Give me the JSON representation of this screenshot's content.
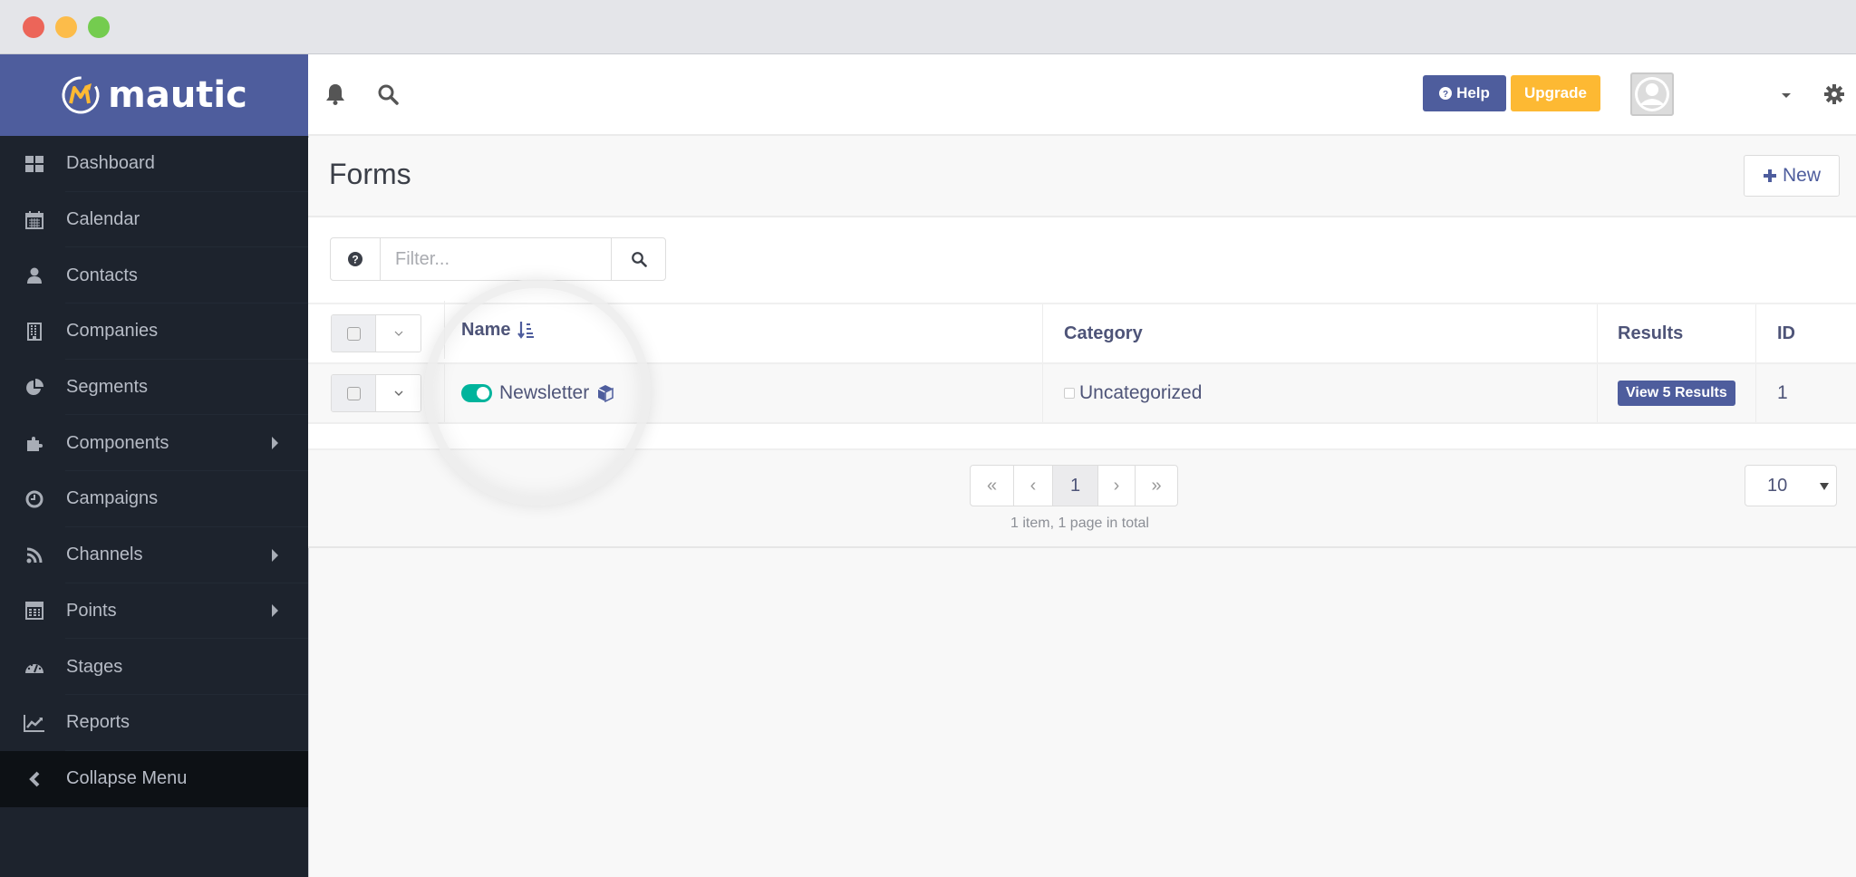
{
  "brand": {
    "name": "mautic",
    "accent": "#4e5d9d",
    "logo_accent": "#fdb933"
  },
  "sidebar": {
    "items": [
      {
        "label": "Dashboard",
        "icon": "dashboard-icon",
        "has_submenu": false
      },
      {
        "label": "Calendar",
        "icon": "calendar-icon",
        "has_submenu": false
      },
      {
        "label": "Contacts",
        "icon": "user-icon",
        "has_submenu": false
      },
      {
        "label": "Companies",
        "icon": "building-icon",
        "has_submenu": false
      },
      {
        "label": "Segments",
        "icon": "pie-chart-icon",
        "has_submenu": false
      },
      {
        "label": "Components",
        "icon": "puzzle-icon",
        "has_submenu": true
      },
      {
        "label": "Campaigns",
        "icon": "clock-icon",
        "has_submenu": false
      },
      {
        "label": "Channels",
        "icon": "rss-icon",
        "has_submenu": true
      },
      {
        "label": "Points",
        "icon": "calculator-icon",
        "has_submenu": true
      },
      {
        "label": "Stages",
        "icon": "tachometer-icon",
        "has_submenu": false
      },
      {
        "label": "Reports",
        "icon": "line-chart-icon",
        "has_submenu": false
      }
    ],
    "collapse_label": "Collapse Menu"
  },
  "topbar": {
    "help_label": "Help",
    "upgrade_label": "Upgrade",
    "help_color": "#4e5d9d",
    "upgrade_color": "#fdb933"
  },
  "page": {
    "title": "Forms",
    "new_label": "New"
  },
  "filter": {
    "placeholder": "Filter...",
    "value": ""
  },
  "table": {
    "columns": [
      "Name",
      "Category",
      "Results",
      "ID"
    ],
    "sort_column": "Name",
    "rows": [
      {
        "name": "Newsletter",
        "published": true,
        "category": "Uncategorized",
        "results_label": "View 5 Results",
        "id": "1"
      }
    ]
  },
  "pagination": {
    "first": "«",
    "prev": "‹",
    "current": "1",
    "next": "›",
    "last": "»",
    "info": "1 item, 1 page in total",
    "limit": "10"
  }
}
